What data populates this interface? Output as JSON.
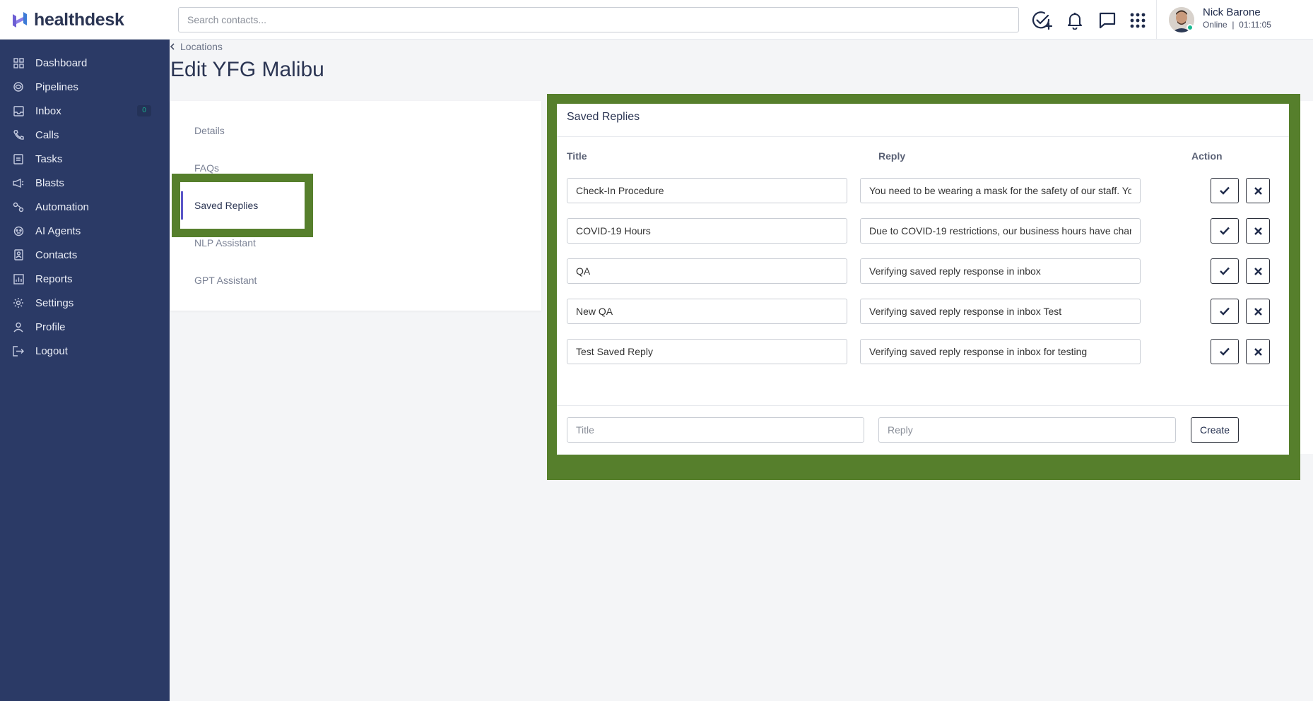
{
  "app": {
    "logo_text": "healthdesk"
  },
  "search": {
    "placeholder": "Search contacts..."
  },
  "user": {
    "name": "Nick Barone",
    "status": "Online  |  01:11:05"
  },
  "sidebar": {
    "items": [
      {
        "label": "Dashboard",
        "icon": "dashboard-icon"
      },
      {
        "label": "Pipelines",
        "icon": "pipelines-icon"
      },
      {
        "label": "Inbox",
        "icon": "inbox-icon",
        "badge": "0"
      },
      {
        "label": "Calls",
        "icon": "phone-icon"
      },
      {
        "label": "Tasks",
        "icon": "tasks-icon"
      },
      {
        "label": "Blasts",
        "icon": "megaphone-icon"
      },
      {
        "label": "Automation",
        "icon": "automation-icon"
      },
      {
        "label": "AI Agents",
        "icon": "ai-agents-icon"
      },
      {
        "label": "Contacts",
        "icon": "contacts-icon"
      },
      {
        "label": "Reports",
        "icon": "reports-icon"
      },
      {
        "label": "Settings",
        "icon": "gear-icon"
      },
      {
        "label": "Profile",
        "icon": "profile-icon"
      },
      {
        "label": "Logout",
        "icon": "logout-icon"
      }
    ]
  },
  "breadcrumb": {
    "label": "Locations"
  },
  "page": {
    "title": "Edit YFG Malibu"
  },
  "tabs": [
    {
      "label": "Details"
    },
    {
      "label": "FAQs"
    },
    {
      "label": "Saved Replies",
      "active": true
    },
    {
      "label": "NLP Assistant"
    },
    {
      "label": "GPT Assistant"
    }
  ],
  "saved_replies": {
    "title": "Saved Replies",
    "columns": {
      "title": "Title",
      "reply": "Reply",
      "action": "Action"
    },
    "rows": [
      {
        "title": "Check-In Procedure",
        "reply": "You need to be wearing a mask for the safety of our staff. Yo"
      },
      {
        "title": "COVID-19 Hours",
        "reply": "Due to COVID-19 restrictions, our business hours have char"
      },
      {
        "title": "QA",
        "reply": "Verifying saved reply response in inbox"
      },
      {
        "title": "New QA",
        "reply": "Verifying saved reply response in inbox Test"
      },
      {
        "title": "Test Saved Reply",
        "reply": "Verifying saved reply response in inbox for testing"
      }
    ],
    "new_entry": {
      "title_placeholder": "Title",
      "reply_placeholder": "Reply",
      "create_label": "Create"
    }
  },
  "colors": {
    "sidebar_bg": "#2b3a66",
    "highlight": "#567f2c",
    "accent": "#5b56c8",
    "online": "#17b890"
  }
}
